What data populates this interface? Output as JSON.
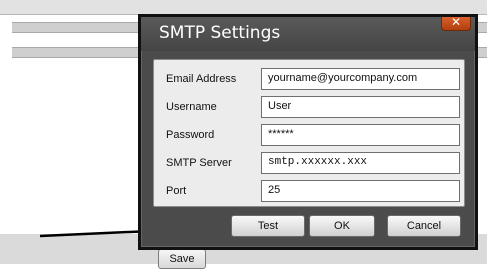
{
  "dialog": {
    "title": "SMTP Settings",
    "close_icon": "close-icon",
    "fields": [
      {
        "label": "Email Address",
        "value": "yourname@yourcompany.com"
      },
      {
        "label": "Username",
        "value": "User"
      },
      {
        "label": "Password",
        "value": "******"
      },
      {
        "label": "SMTP Server",
        "value": "smtp.xxxxxx.xxx"
      },
      {
        "label": "Port",
        "value": "25"
      }
    ],
    "buttons": {
      "test": "Test",
      "ok": "OK",
      "cancel": "Cancel"
    }
  },
  "background": {
    "save_label": "Save"
  },
  "colors": {
    "dialog_bg": "#4b4b4b",
    "close_button": "#c94b16",
    "panel_bg": "#ececec"
  }
}
